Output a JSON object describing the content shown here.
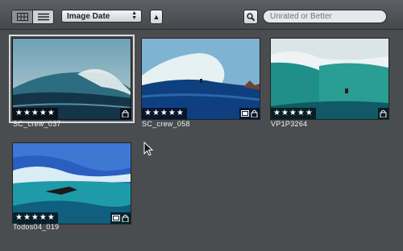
{
  "toolbar": {
    "sort_value": "Image Date",
    "filter_placeholder": "Unrated or Better"
  },
  "photos": [
    {
      "name": "SC_crew_037",
      "stars": "★★★★★",
      "selected": true
    },
    {
      "name": "SC_crew_058",
      "stars": "★★★★★",
      "selected": false
    },
    {
      "name": "VP1P3264",
      "stars": "★★★★★",
      "selected": false
    },
    {
      "name": "Todos04_019",
      "stars": "★★★★★",
      "selected": false
    }
  ],
  "icons": {
    "grid_view": "grid-view-icon",
    "list_view": "list-view-icon",
    "sort_direction": "sort-ascending-icon",
    "search": "magnifier-icon",
    "adjusted": "adjustments-badge-icon",
    "locked": "lock-badge-icon"
  },
  "colors": {
    "background": "#4a4c50",
    "toolbar": "#5c5f64",
    "selection": "#d9dadc"
  }
}
